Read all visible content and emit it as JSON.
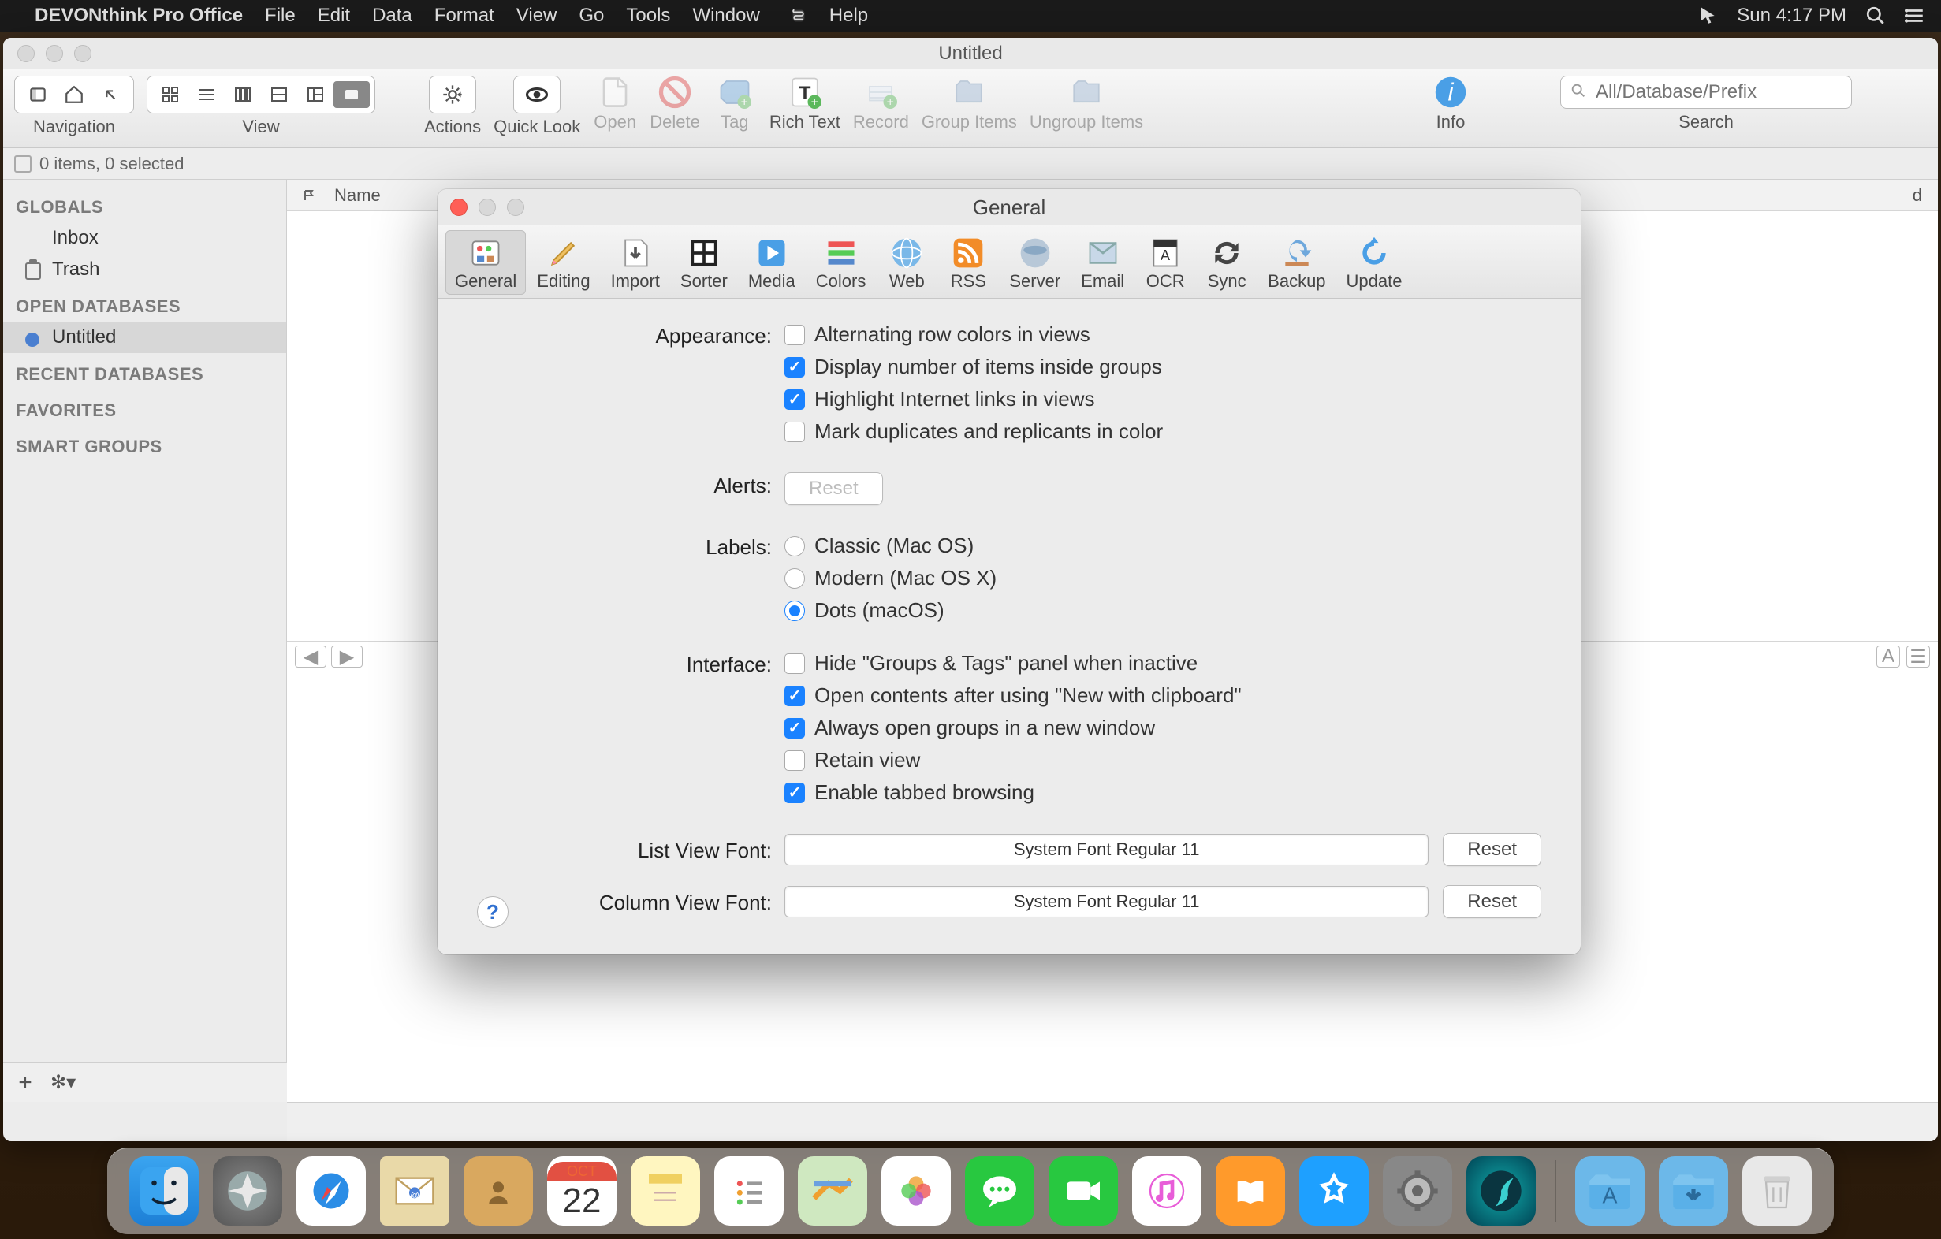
{
  "menubar": {
    "app_name": "DEVONthink Pro Office",
    "items": [
      "File",
      "Edit",
      "Data",
      "Format",
      "View",
      "Go",
      "Tools",
      "Window",
      "Help"
    ],
    "clock": "Sun 4:17 PM"
  },
  "main_window": {
    "title": "Untitled",
    "toolbar": {
      "navigation_label": "Navigation",
      "view_label": "View",
      "actions_label": "Actions",
      "quicklook_label": "Quick Look",
      "open_label": "Open",
      "delete_label": "Delete",
      "tag_label": "Tag",
      "richtext_label": "Rich Text",
      "record_label": "Record",
      "groupitems_label": "Group Items",
      "ungroupitems_label": "Ungroup Items",
      "info_label": "Info",
      "search_label": "Search",
      "search_placeholder": "All/Database/Prefix"
    },
    "status_line": "0 items, 0 selected",
    "sidebar": {
      "globals_label": "GLOBALS",
      "inbox_label": "Inbox",
      "trash_label": "Trash",
      "open_db_label": "OPEN DATABASES",
      "untitled_db": "Untitled",
      "recent_db_label": "RECENT DATABASES",
      "favorites_label": "FAVORITES",
      "smart_groups_label": "SMART GROUPS"
    },
    "content_header": {
      "name_col": "Name",
      "last_col": "d"
    }
  },
  "preferences": {
    "title": "General",
    "tabs": [
      "General",
      "Editing",
      "Import",
      "Sorter",
      "Media",
      "Colors",
      "Web",
      "RSS",
      "Server",
      "Email",
      "OCR",
      "Sync",
      "Backup",
      "Update"
    ],
    "appearance": {
      "label": "Appearance:",
      "alternating": "Alternating row colors in views",
      "display_number": "Display number of items inside groups",
      "highlight_links": "Highlight Internet links in views",
      "mark_duplicates": "Mark duplicates and replicants in color"
    },
    "alerts": {
      "label": "Alerts:",
      "reset": "Reset"
    },
    "labels": {
      "label": "Labels:",
      "classic": "Classic (Mac OS)",
      "modern": "Modern (Mac OS X)",
      "dots": "Dots (macOS)"
    },
    "interface": {
      "label": "Interface:",
      "hide_groups": "Hide \"Groups & Tags\" panel when inactive",
      "open_clipboard": "Open contents after using \"New with clipboard\"",
      "always_new_window": "Always open groups in a new window",
      "retain_view": "Retain view",
      "tabbed": "Enable tabbed browsing"
    },
    "list_view_font_label": "List View Font:",
    "list_view_font": "System Font Regular 11",
    "column_view_font_label": "Column View Font:",
    "column_view_font": "System Font Regular 11",
    "reset_btn": "Reset"
  },
  "dock": {
    "cal_month": "OCT",
    "cal_day": "22"
  }
}
